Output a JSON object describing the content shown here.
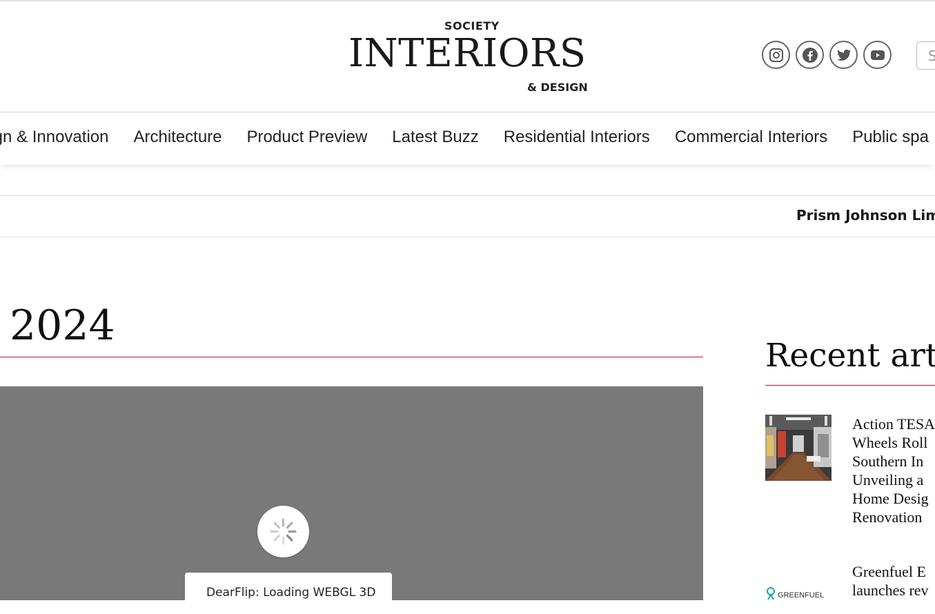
{
  "header": {
    "logo_top": "SOCIETY",
    "logo_main": "INTERIORS",
    "logo_bottom": "& DESIGN",
    "social_icons": [
      "instagram-icon",
      "facebook-icon",
      "twitter-icon",
      "youtube-icon"
    ],
    "search_placeholder": "S"
  },
  "nav": {
    "items": [
      {
        "label": "esign & Innovation"
      },
      {
        "label": "Architecture"
      },
      {
        "label": "Product Preview"
      },
      {
        "label": "Latest Buzz"
      },
      {
        "label": "Residential Interiors"
      },
      {
        "label": "Commercial Interiors"
      },
      {
        "label": "Public spa"
      }
    ]
  },
  "ticker": {
    "text": "Prism Johnson Limit"
  },
  "main": {
    "title": "2024",
    "flipbook": {
      "loading_text": "DearFlip: Loading WEBGL 3D"
    }
  },
  "sidebar": {
    "title": "Recent artic",
    "articles": [
      {
        "lines": [
          "Action TESA",
          "Wheels Roll",
          "Southern In",
          "Unveiling a",
          "Home Desig",
          "Renovation"
        ]
      },
      {
        "lines": [
          "Greenfuel E",
          "launches rev"
        ],
        "thumb_text": "GREENFUEL"
      }
    ]
  },
  "colors": {
    "accent": "#c8102e",
    "flipbook_bg": "#797979",
    "greenfuel": "#1aa3a3"
  }
}
